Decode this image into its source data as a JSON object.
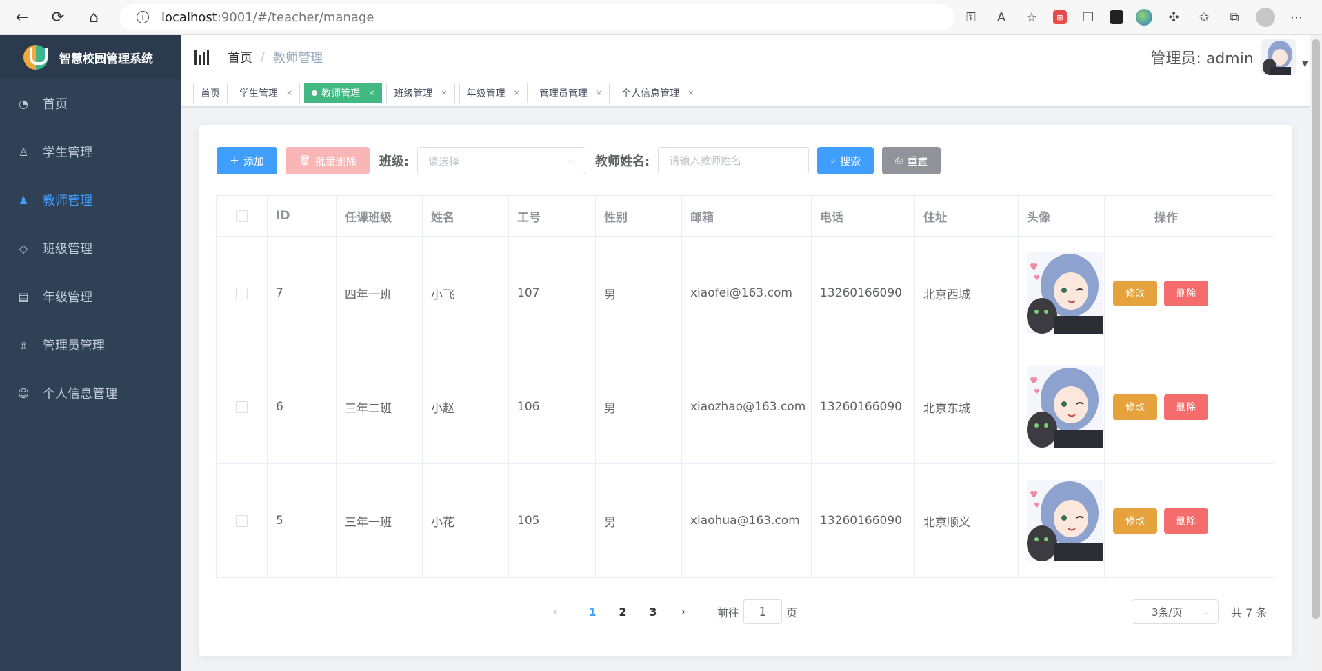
{
  "browser": {
    "url_host": "localhost",
    "url_path": ":9001/#/teacher/manage"
  },
  "sidebar": {
    "logo_text": "智慧校园管理系统",
    "items": [
      {
        "label": "首页",
        "icon": "dashboard-icon"
      },
      {
        "label": "学生管理",
        "icon": "user-icon"
      },
      {
        "label": "教师管理",
        "icon": "teacher-icon"
      },
      {
        "label": "班级管理",
        "icon": "tag-icon"
      },
      {
        "label": "年级管理",
        "icon": "calendar-icon"
      },
      {
        "label": "管理员管理",
        "icon": "users-icon"
      },
      {
        "label": "个人信息管理",
        "icon": "profile-icon"
      }
    ],
    "active_color": "#409eff",
    "bg_color": "#304156"
  },
  "header": {
    "breadcrumb_home": "首页",
    "breadcrumb_sep": "/",
    "breadcrumb_current": "教师管理",
    "user_label": "管理员: admin"
  },
  "tags": [
    {
      "label": "首页"
    },
    {
      "label": "学生管理"
    },
    {
      "label": "教师管理"
    },
    {
      "label": "班级管理"
    },
    {
      "label": "年级管理"
    },
    {
      "label": "管理员管理"
    },
    {
      "label": "个人信息管理"
    }
  ],
  "toolbar": {
    "add_label": "添加",
    "batch_delete_label": "批量删除",
    "class_label": "班级:",
    "class_placeholder": "请选择",
    "teacher_name_label": "教师姓名:",
    "teacher_name_placeholder": "请输入教师姓名",
    "search_label": "搜索",
    "reset_label": "重置"
  },
  "table": {
    "columns": [
      "",
      "ID",
      "任课班级",
      "姓名",
      "工号",
      "性别",
      "邮箱",
      "电话",
      "住址",
      "头像",
      "操作"
    ],
    "edit_label": "修改",
    "delete_label": "删除",
    "rows": [
      {
        "id": "7",
        "class": "四年一班",
        "name": "小飞",
        "no": "107",
        "gender": "男",
        "email": "xiaofei@163.com",
        "phone": "13260166090",
        "address": "北京西城"
      },
      {
        "id": "6",
        "class": "三年二班",
        "name": "小赵",
        "no": "106",
        "gender": "男",
        "email": "xiaozhao@163.com",
        "phone": "13260166090",
        "address": "北京东城"
      },
      {
        "id": "5",
        "class": "三年一班",
        "name": "小花",
        "no": "105",
        "gender": "男",
        "email": "xiaohua@163.com",
        "phone": "13260166090",
        "address": "北京顺义"
      }
    ]
  },
  "pagination": {
    "pages": [
      "1",
      "2",
      "3"
    ],
    "current": "1",
    "goto_prefix": "前往",
    "goto_value": "1",
    "goto_suffix": "页",
    "page_size": "3条/页",
    "total": "共 7 条"
  }
}
